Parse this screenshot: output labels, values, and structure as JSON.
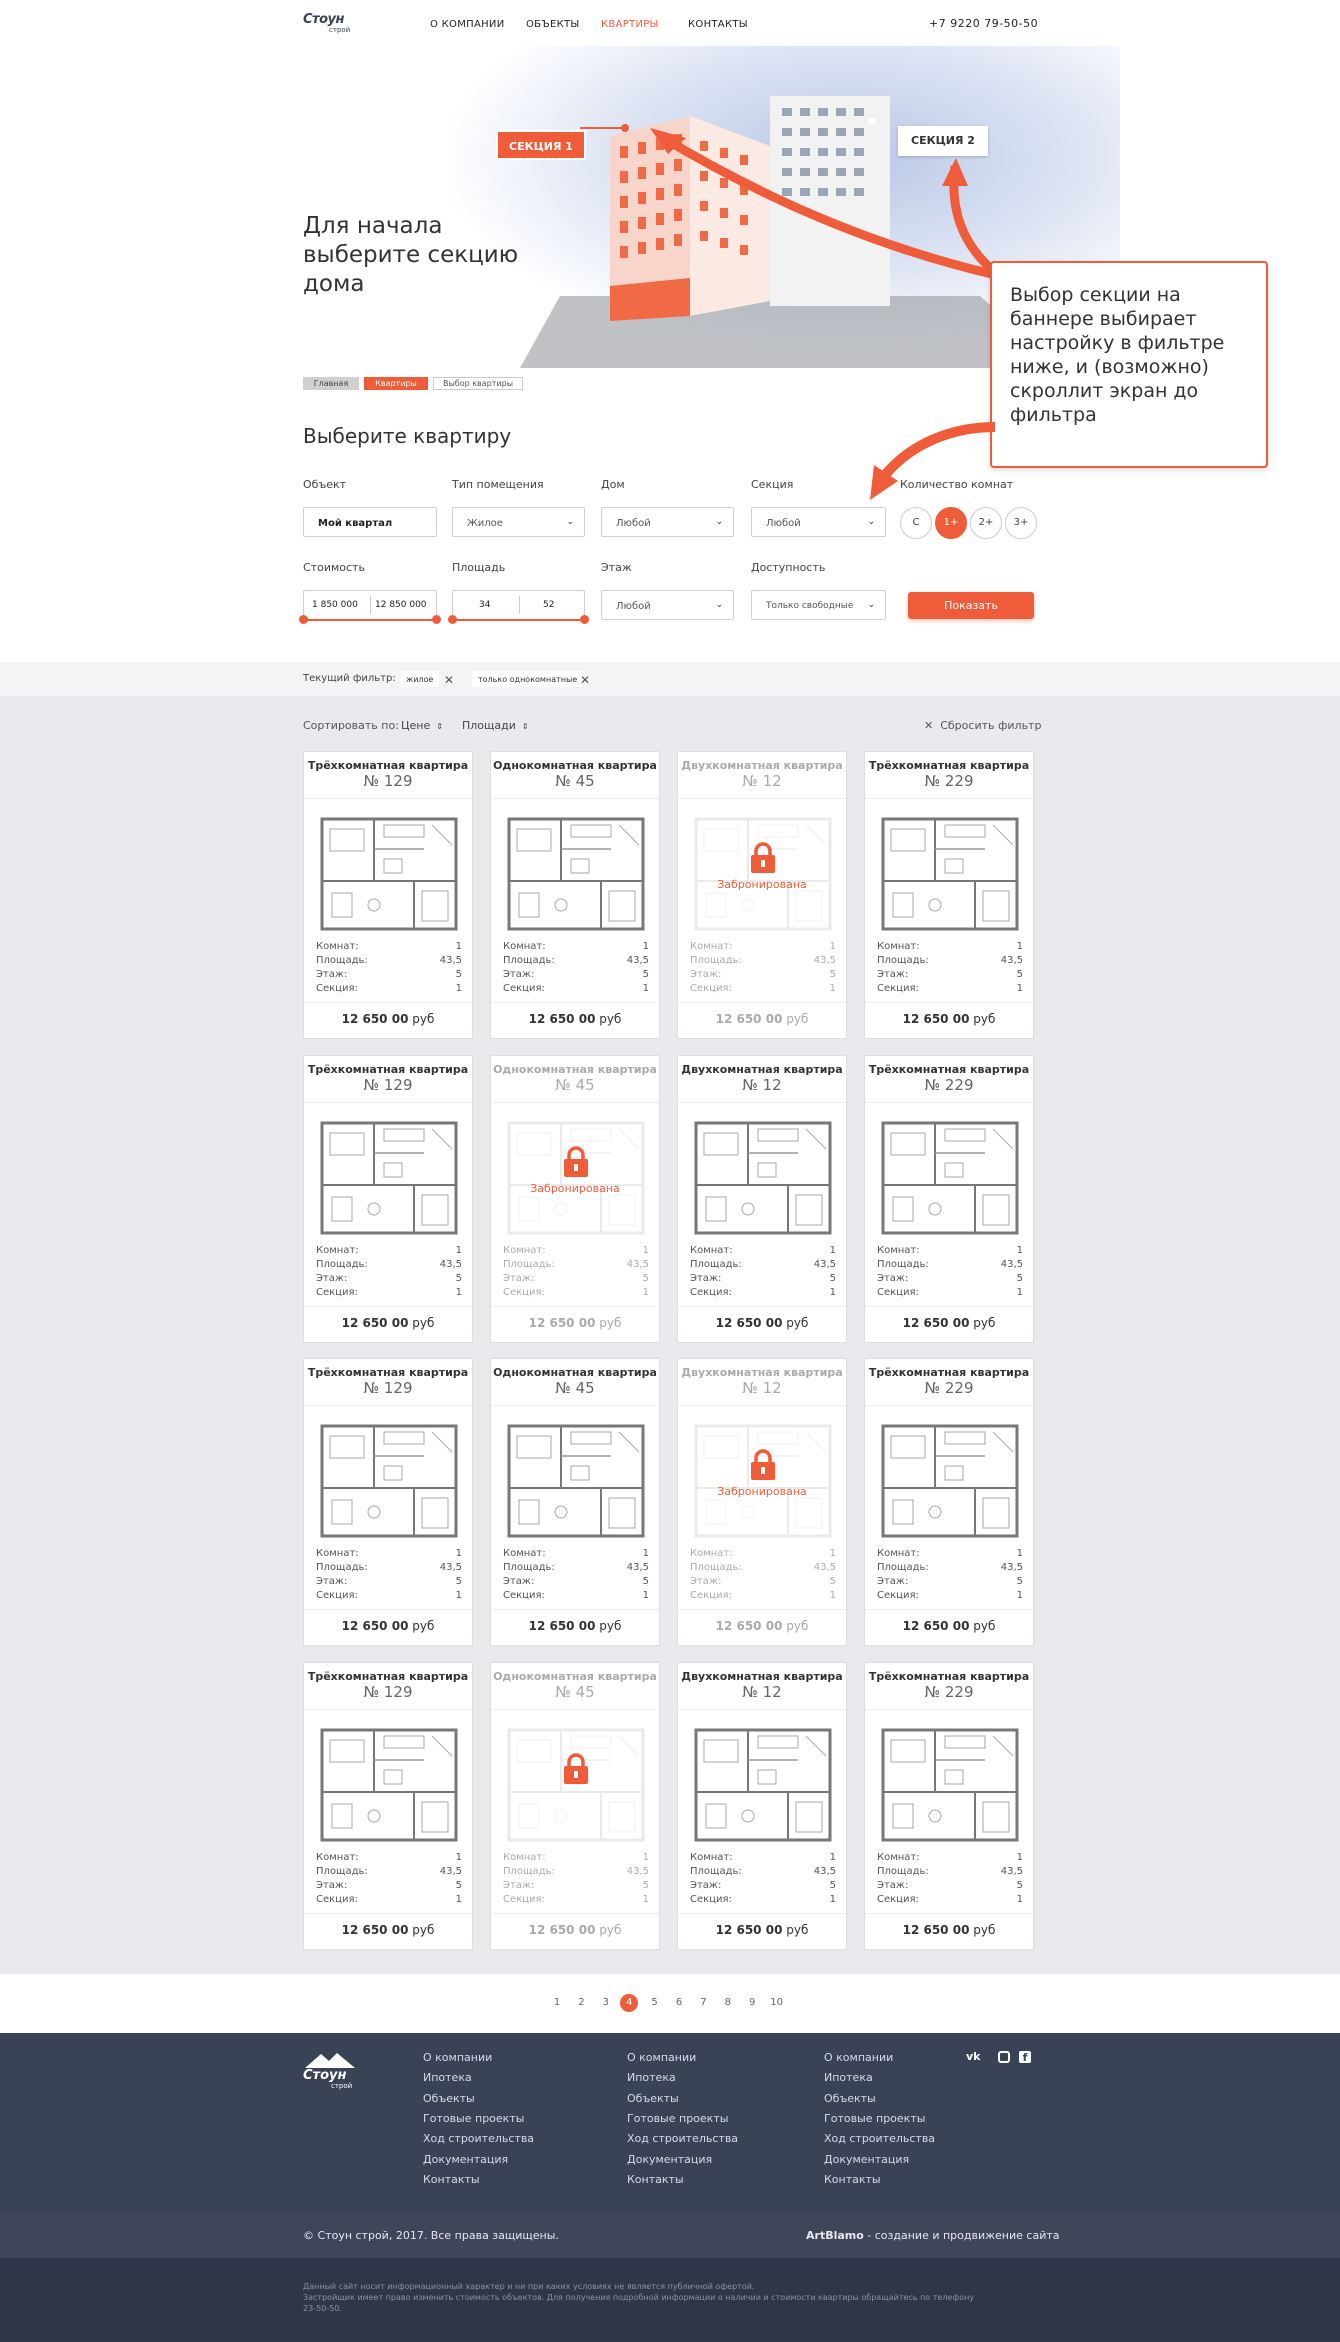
{
  "header": {
    "logo_main": "Стоун",
    "logo_sub": "строй",
    "nav": [
      "О КОМПАНИИ",
      "ОБЪЕКТЫ",
      "КВАРТИРЫ",
      "КОНТАКТЫ"
    ],
    "phone": "+7 9220  79-50-50"
  },
  "hero": {
    "title": "Для начала выберите секцию дома",
    "section1": "СЕКЦИЯ 1",
    "section2": "СЕКЦИЯ 2",
    "note": "Выбор секции на баннере выбирает настройку в фильтре ниже, и (возможно) скроллит экран до фильтра"
  },
  "breadcrumbs": [
    "Главная",
    "Квартиры",
    "Выбор квартиры"
  ],
  "filter": {
    "title": "Выберите квартиру",
    "object_label": "Объект",
    "object_value": "Мой квартал",
    "type_label": "Тип помещения",
    "type_value": "Жилое",
    "house_label": "Дом",
    "house_value": "Любой",
    "section_label": "Секция",
    "section_value": "Любой",
    "rooms_label": "Количество комнат",
    "rooms": [
      "С",
      "1+",
      "2+",
      "3+"
    ],
    "price_label": "Стоимость",
    "price_from": "1 850 000",
    "price_to": "12 850 000",
    "area_label": "Площадь",
    "area_from": "34",
    "area_to": "52",
    "floor_label": "Этаж",
    "floor_value": "Любой",
    "avail_label": "Доступность",
    "avail_value": "Только свободные",
    "show_button": "Показать"
  },
  "current_filter": {
    "label": "Текущий фильтр:",
    "chips": [
      "жилое",
      "только однокомнатные"
    ]
  },
  "sort": {
    "label": "Сортировать по:",
    "by_price": "Цене",
    "by_area": "Площади",
    "reset": "Сбросить фильтр"
  },
  "cards": [
    {
      "title": "Трёхкомнатная квартира",
      "num": "№ 129",
      "booked": false
    },
    {
      "title": "Однокомнатная квартира",
      "num": "№ 45",
      "booked": false
    },
    {
      "title": "Двухкомнатная квартира",
      "num": "№ 12",
      "booked": true
    },
    {
      "title": "Трёхкомнатная квартира",
      "num": "№ 229",
      "booked": false
    },
    {
      "title": "Трёхкомнатная квартира",
      "num": "№ 129",
      "booked": false
    },
    {
      "title": "Однокомнатная квартира",
      "num": "№ 45",
      "booked": true
    },
    {
      "title": "Двухкомнатная квартира",
      "num": "№ 12",
      "booked": false
    },
    {
      "title": "Трёхкомнатная квартира",
      "num": "№ 229",
      "booked": false
    },
    {
      "title": "Трёхкомнатная квартира",
      "num": "№ 129",
      "booked": false
    },
    {
      "title": "Однокомнатная квартира",
      "num": "№ 45",
      "booked": false
    },
    {
      "title": "Двухкомнатная квартира",
      "num": "№ 12",
      "booked": true
    },
    {
      "title": "Трёхкомнатная квартира",
      "num": "№ 229",
      "booked": false
    },
    {
      "title": "Трёхкомнатная квартира",
      "num": "№ 129",
      "booked": false
    },
    {
      "title": "Однокомнатная квартира",
      "num": "№ 45",
      "booked": true
    },
    {
      "title": "Двухкомнатная квартира",
      "num": "№ 12",
      "booked": false
    },
    {
      "title": "Трёхкомнатная квартира",
      "num": "№ 229",
      "booked": false
    }
  ],
  "card_specs": {
    "rooms_label": "Комнат:",
    "area_label": "Площадь:",
    "floor_label": "Этаж:",
    "section_label": "Секция:",
    "rooms": "1",
    "area": "43,5",
    "floor": "5",
    "section": "1",
    "price": "12 650 00",
    "currency": "руб",
    "booked_label": "Забронирована"
  },
  "booked_label_shown": [
    true,
    true,
    true,
    false
  ],
  "pagination": [
    "1",
    "2",
    "3",
    "4",
    "5",
    "6",
    "7",
    "8",
    "9",
    "10"
  ],
  "pagination_active": "4",
  "footer": {
    "links": [
      "О компании",
      "Ипотека",
      "Объекты",
      "Готовые проекты",
      "Ход строительства",
      "Документация",
      "Контакты"
    ],
    "social": [
      "vk-icon",
      "instagram-icon",
      "facebook-icon"
    ],
    "copyright": "© Стоун строй, 2017. Все права защищены.",
    "dev_name": "ArtBlamo",
    "dev_text": " - создание и продвижение сайта",
    "disclaimer1": "Данный сайт носит информационный характер и ни при каких условиях не является публичной офертой.",
    "disclaimer2": "Застройщик имеет право изменить стоимость объектов. Для получения подробной информации о наличии и стоимости квартиры обращайтесь по телефону",
    "disclaimer3": "23-50-50."
  },
  "colors": {
    "accent": "#ef5c3a",
    "footer_bg": "#3a4256",
    "footer_dark": "#2f3647",
    "grey_bg": "#e9eaee"
  }
}
